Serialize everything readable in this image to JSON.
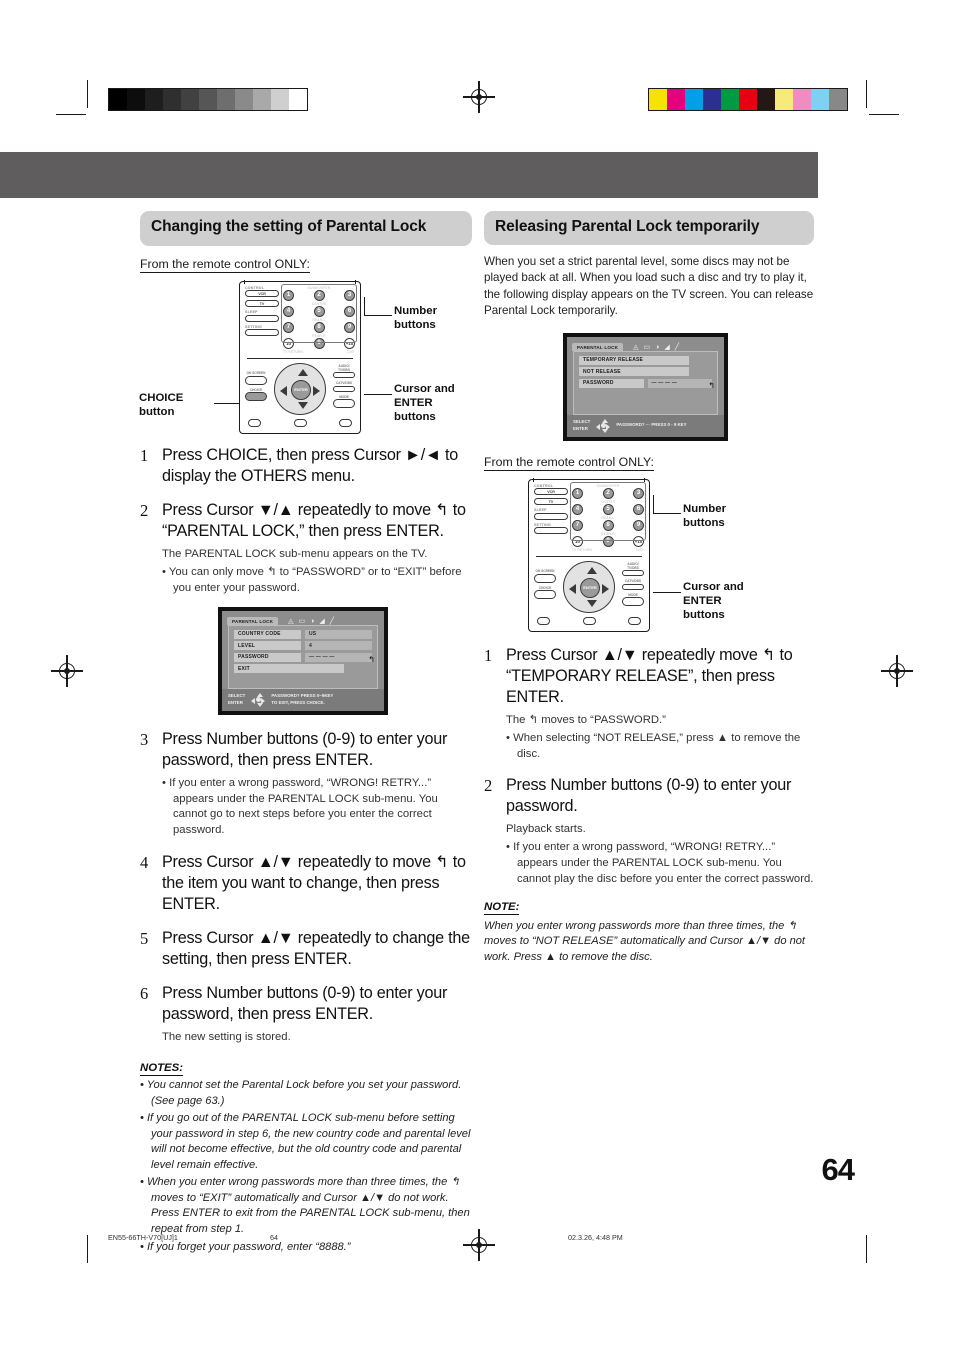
{
  "page": {
    "number": "64",
    "footer_left": "EN55-66TH-V70[UJ]1",
    "footer_center": "64",
    "footer_right": "02.3.26, 4:48 PM"
  },
  "left_column": {
    "heading": "Changing the setting of Parental Lock",
    "from_remote": "From the remote control ONLY:",
    "remote_callouts": {
      "number_buttons": "Number buttons",
      "cursor_enter": "Cursor and ENTER buttons",
      "choice": "CHOICE button"
    },
    "steps": [
      {
        "num": "1",
        "main": "Press CHOICE, then press Cursor ►/◄ to display the OTHERS menu.",
        "sub": "",
        "bullets": []
      },
      {
        "num": "2",
        "main": "Press Cursor ▼/▲ repeatedly to move ↰ to “PARENTAL LOCK,” then press ENTER.",
        "sub": "The PARENTAL LOCK sub-menu appears on the TV.",
        "bullets": [
          "• You can only move ↰ to “PASSWORD” or to “EXIT” before you enter your password."
        ]
      },
      {
        "num": "3",
        "main": "Press Number buttons (0-9) to enter your password, then press ENTER.",
        "sub": "",
        "bullets": [
          "• If you enter a wrong password, “WRONG! RETRY...” appears under the PARENTAL LOCK sub-menu. You cannot go to next steps before you enter the correct password."
        ]
      },
      {
        "num": "4",
        "main": "Press Cursor ▲/▼ repeatedly to move ↰ to the item you want to change, then press ENTER.",
        "sub": "",
        "bullets": []
      },
      {
        "num": "5",
        "main": "Press Cursor ▲/▼ repeatedly to change the setting, then press ENTER.",
        "sub": "",
        "bullets": []
      },
      {
        "num": "6",
        "main": "Press Number buttons (0-9) to enter your password, then press ENTER.",
        "sub": "The new setting is stored.",
        "bullets": []
      }
    ],
    "tv_screen": {
      "tab": "PARENTAL LOCK",
      "rows": [
        {
          "label": "COUNTRY CODE",
          "value": "US"
        },
        {
          "label": "LEVEL",
          "value": "4"
        },
        {
          "label": "PASSWORD",
          "value": "— — — —"
        },
        {
          "label": "EXIT",
          "value": ""
        }
      ],
      "footer_left_1": "SELECT",
      "footer_left_2": "ENTER",
      "footer_right_1": "PASSWORD? PRESS 0~9KEY",
      "footer_right_2": "TO EXIT, PRESS CHOICE."
    },
    "notes_title": "NOTES:",
    "notes": [
      "• You cannot set the Parental Lock before you set your password. (See page 63.)",
      "• If you go out of the PARENTAL LOCK sub-menu before setting your password in step 6, the new country code and parental level will not become effective, but the old country code and parental level remain effective.",
      "• When you enter wrong passwords more than three times, the ↰ moves to “EXIT” automatically and Cursor ▲/▼ do not work. Press ENTER to exit from the PARENTAL LOCK sub-menu, then repeat from step 1.",
      "• If you forget your password, enter “8888.”"
    ]
  },
  "right_column": {
    "heading": "Releasing Parental Lock temporarily",
    "lead": "When you set a strict parental level, some discs may not be played back at all. When you load such a disc and try to play it, the following display appears on the TV screen. You can release Parental Lock temporarily.",
    "from_remote": "From the remote control ONLY:",
    "remote_callouts": {
      "number_buttons": "Number buttons",
      "cursor_enter": "Cursor and ENTER buttons"
    },
    "tv_screen": {
      "tab": "PARENTAL LOCK",
      "rows": [
        {
          "label": "TEMPORARY RELEASE",
          "value": ""
        },
        {
          "label": "NOT RELEASE",
          "value": ""
        },
        {
          "label": "PASSWORD",
          "value": "— — — —"
        }
      ],
      "footer_left_1": "SELECT",
      "footer_left_2": "ENTER",
      "footer_right_1": "PASSWORD? ··· PRESS 0 - 9 KEY",
      "footer_right_2": ""
    },
    "steps": [
      {
        "num": "1",
        "main": "Press Cursor ▲/▼ repeatedly move ↰ to “TEMPORARY RELEASE”, then press ENTER.",
        "sub": "The ↰ moves to “PASSWORD.”",
        "bullets": [
          "• When selecting “NOT RELEASE,” press ▲ to remove the disc."
        ]
      },
      {
        "num": "2",
        "main": "Press Number buttons (0-9) to enter your password.",
        "sub": "Playback starts.",
        "bullets": [
          "• If you enter a wrong password, “WRONG! RETRY...” appears under the PARENTAL LOCK sub-menu. You cannot play the disc before you enter the correct password."
        ]
      }
    ],
    "note_title": "NOTE:",
    "note_body": "When you enter wrong passwords more than three times, the ↰ moves to “NOT RELEASE” automatically and Cursor ▲/▼ do not work. Press ▲ to remove the disc."
  },
  "print_marks": {
    "gray_ramp": [
      "#000000",
      "#0d0d0d",
      "#1e1e1e",
      "#2f2f2f",
      "#414141",
      "#565656",
      "#6e6e6e",
      "#8a8a8a",
      "#a9a9a9",
      "#cfcfcf",
      "#ffffff"
    ],
    "color_bars": [
      "#f5e400",
      "#e5007d",
      "#00a0e9",
      "#2b2f8f",
      "#009944",
      "#e60012",
      "#231815",
      "#f5ea7a",
      "#f18cc0",
      "#7fd0f2",
      "#888888"
    ],
    "band_color": "#5f5d5e"
  },
  "remote": {
    "control_label": "CONTROL",
    "vcr": "VCR",
    "tv": "TV",
    "sleep": "SLEEP",
    "setting": "SETTING",
    "subwoofer": "SUBWOOFER",
    "center": "CENTER",
    "rear_l": "REAR-L",
    "rear_r": "REAR-R",
    "effect": "EFFECT",
    "test": "TEST",
    "keys": [
      "1",
      "2",
      "3",
      "4",
      "5",
      "6",
      "7",
      "8",
      "9"
    ],
    "key_10": "10",
    "key_0": "0",
    "key_plus10": "+10",
    "tv_return": "TV RETURN",
    "hundred": "100+",
    "on_screen": "ON SCREEN",
    "choice": "CHOICE",
    "enter": "ENTER",
    "audio_tvdbs": "AUDIO/ TV/DBS",
    "catv_dbs": "CATV/DBS",
    "mode": "MODE"
  }
}
